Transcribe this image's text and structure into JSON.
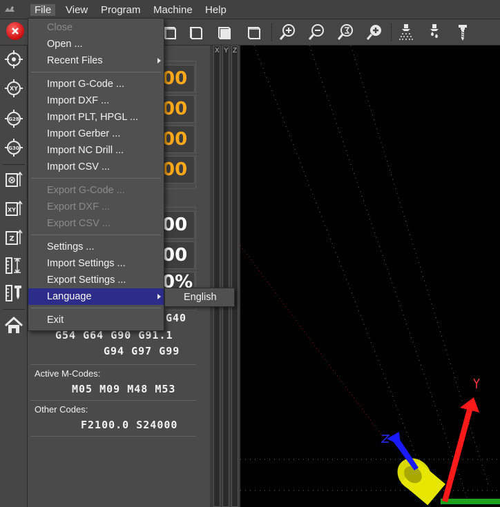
{
  "menubar": {
    "items": [
      "File",
      "View",
      "Program",
      "Machine",
      "Help"
    ]
  },
  "toolbar": {
    "icons": [
      "stop-icon",
      "view-front-icon",
      "view-side-icon",
      "view-top-icon",
      "view-iso-icon",
      "zoom-in-icon",
      "zoom-out-icon",
      "zoom-fit-icon",
      "zoom-extents-icon",
      "coolant-mist-icon",
      "coolant-flood-icon",
      "spindle-icon"
    ]
  },
  "left_column": {
    "icons": [
      "probe-target-icon",
      "probe-xy-icon",
      "probe-g28-icon",
      "probe-g30-icon",
      "zero-all-icon",
      "zero-xy-icon",
      "zero-z-icon",
      "height-map-icon",
      "tool-length-icon",
      "home-icon"
    ]
  },
  "dro": {
    "values": [
      "00",
      "00",
      "00",
      "00"
    ],
    "secondary_values": [
      "00",
      "00",
      "0%"
    ]
  },
  "gcodes": {
    "line1": "G40",
    "line2": "G54  G64  G90  G91.1",
    "line3": "G94  G97  G99"
  },
  "mcodes": {
    "label": "Active M-Codes:",
    "values": "M05  M09  M48  M53"
  },
  "other": {
    "label": "Other Codes:",
    "values": "F2100.0  S24000"
  },
  "axis_labels": [
    "X",
    "Y",
    "Z"
  ],
  "file_menu": {
    "items": [
      {
        "label": "Close",
        "enabled": false
      },
      {
        "label": "Open ...",
        "enabled": true
      },
      {
        "label": "Recent Files",
        "enabled": true,
        "submenu": true
      },
      {
        "label": "Import G-Code ...",
        "enabled": true
      },
      {
        "label": "Import DXF ...",
        "enabled": true
      },
      {
        "label": "Import PLT, HPGL ...",
        "enabled": true
      },
      {
        "label": "Import Gerber ...",
        "enabled": true
      },
      {
        "label": "Import NC Drill ...",
        "enabled": true
      },
      {
        "label": "Import CSV ...",
        "enabled": true
      },
      {
        "label": "Export G-Code ...",
        "enabled": false
      },
      {
        "label": "Export DXF ...",
        "enabled": false
      },
      {
        "label": "Export CSV ...",
        "enabled": false
      },
      {
        "label": "Settings ...",
        "enabled": true
      },
      {
        "label": "Import Settings ...",
        "enabled": true
      },
      {
        "label": "Export Settings ...",
        "enabled": true
      },
      {
        "label": "Language",
        "enabled": true,
        "submenu": true,
        "highlighted": true
      },
      {
        "label": "Exit",
        "enabled": true
      }
    ]
  },
  "language_submenu": {
    "items": [
      "English"
    ]
  },
  "viewport": {
    "gizmo_labels": [
      "Y",
      "Z"
    ]
  },
  "colors": {
    "dro_value": "#ffa81a",
    "menu_highlight": "#2c2c8a",
    "stop_button": "#d11212",
    "axis_x": "#1fa31f",
    "axis_y": "#ff1a1a",
    "axis_z": "#1a1aff",
    "tool": "#e6e600"
  }
}
